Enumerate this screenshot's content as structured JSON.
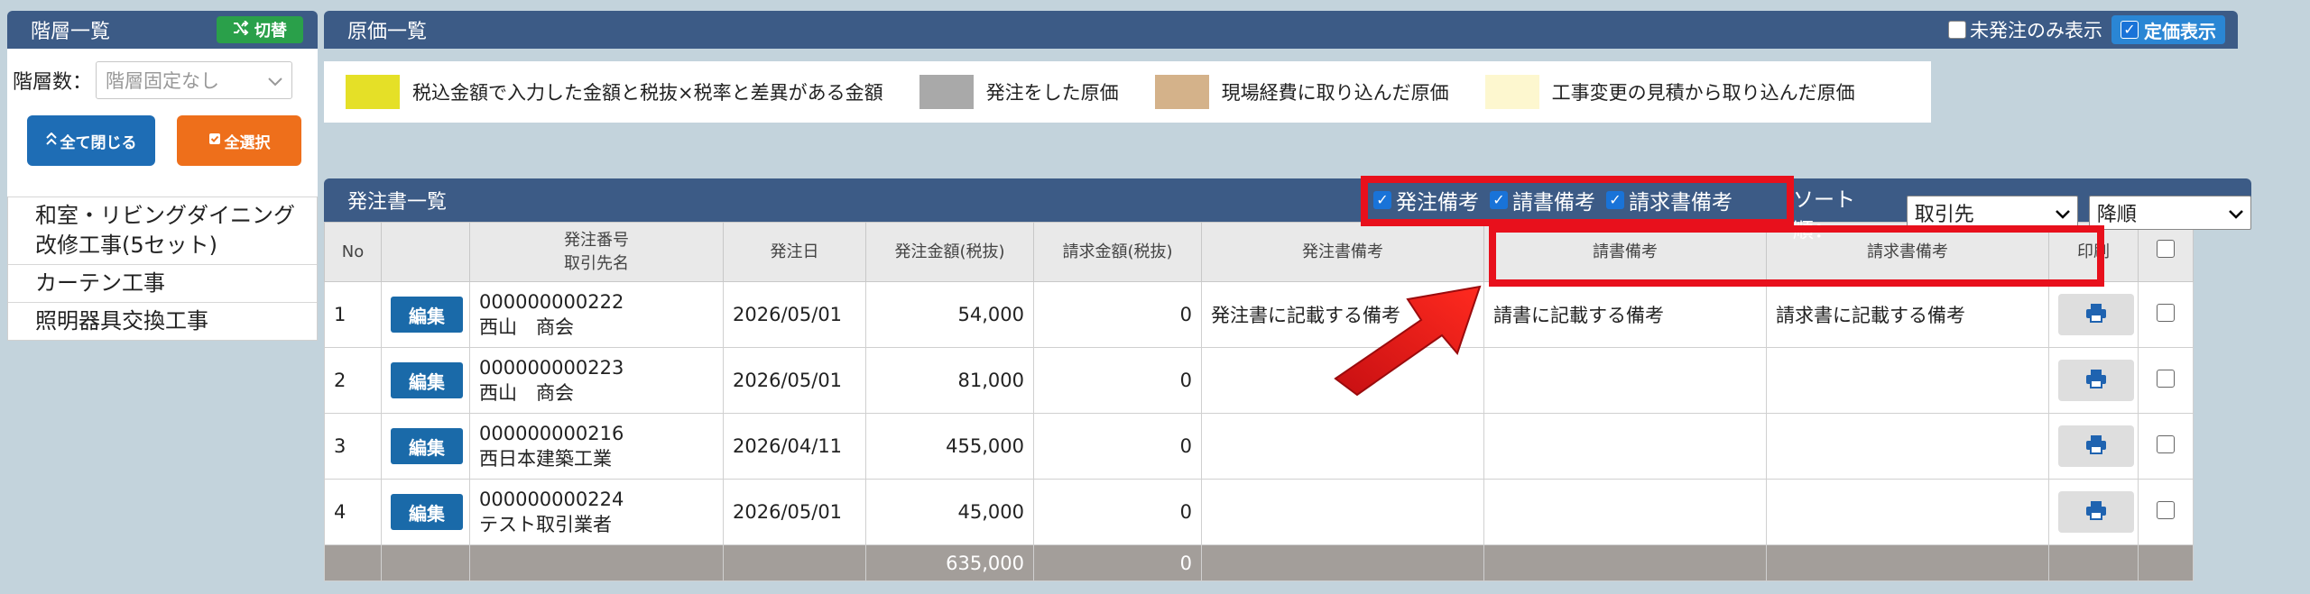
{
  "left_panel": {
    "title": "階層一覧",
    "switch_label": "切替",
    "level_label": "階層数：",
    "level_value": "階層固定なし",
    "collapse_label": "全て閉じる",
    "select_all_label": "全選択",
    "tree_items": [
      {
        "label": "和室・リビングダイニング改修工事(5セット)"
      },
      {
        "label": "カーテン工事"
      },
      {
        "label": "照明器具交換工事"
      }
    ]
  },
  "main": {
    "title": "原価一覧",
    "unordered_only_label": "未発注のみ表示",
    "unit_price_label": "定価表示",
    "legend": [
      {
        "color": "#e5e027",
        "label": "税込金額で入力した金額と税抜×税率と差異がある金額"
      },
      {
        "color": "#a9a9a9",
        "label": "発注をした原価"
      },
      {
        "color": "#d4b28a",
        "label": "現場経費に取り込んだ原価"
      },
      {
        "color": "#fdf7cf",
        "label": "工事変更の見積から取り込んだ原価"
      }
    ]
  },
  "order_list": {
    "title": "発注書一覧",
    "filters": [
      {
        "label": "発注備考",
        "checked": true
      },
      {
        "label": "請書備考",
        "checked": true
      },
      {
        "label": "請求書備考",
        "checked": true
      }
    ],
    "sort_label": "ソート順：",
    "sort_field": "取引先",
    "sort_direction": "降順",
    "columns": {
      "no": "No",
      "order_no": "発注番号",
      "vendor": "取引先名",
      "order_date": "発注日",
      "order_amount": "発注金額(税抜)",
      "invoice_amount": "請求金額(税抜)",
      "order_note": "発注書備考",
      "acceptance_note": "請書備考",
      "invoice_note": "請求書備考",
      "print": "印刷"
    },
    "edit_label": "編集",
    "rows": [
      {
        "no": "1",
        "order_no": "000000000222",
        "vendor": "西山　商会",
        "date": "2026/05/01",
        "order_amount": "54,000",
        "invoice_amount": "0",
        "order_note": "発注書に記載する備考",
        "acceptance_note": "請書に記載する備考",
        "invoice_note": "請求書に記載する備考"
      },
      {
        "no": "2",
        "order_no": "000000000223",
        "vendor": "西山　商会",
        "date": "2026/05/01",
        "order_amount": "81,000",
        "invoice_amount": "0",
        "order_note": "",
        "acceptance_note": "",
        "invoice_note": ""
      },
      {
        "no": "3",
        "order_no": "000000000216",
        "vendor": "西日本建築工業",
        "date": "2026/04/11",
        "order_amount": "455,000",
        "invoice_amount": "0",
        "order_note": "",
        "acceptance_note": "",
        "invoice_note": ""
      },
      {
        "no": "4",
        "order_no": "000000000224",
        "vendor": "テスト取引業者",
        "date": "2026/05/01",
        "order_amount": "45,000",
        "invoice_amount": "0",
        "order_note": "",
        "acceptance_note": "",
        "invoice_note": ""
      }
    ],
    "total": {
      "order_amount": "635,000",
      "invoice_amount": "0"
    }
  },
  "colors": {
    "header_bg": "#3c5b86",
    "edit_button": "#1a6aa9",
    "select_all_button": "#ee6f1b",
    "switch_button": "#2aa04a",
    "annotation_red": "#e8101c"
  }
}
